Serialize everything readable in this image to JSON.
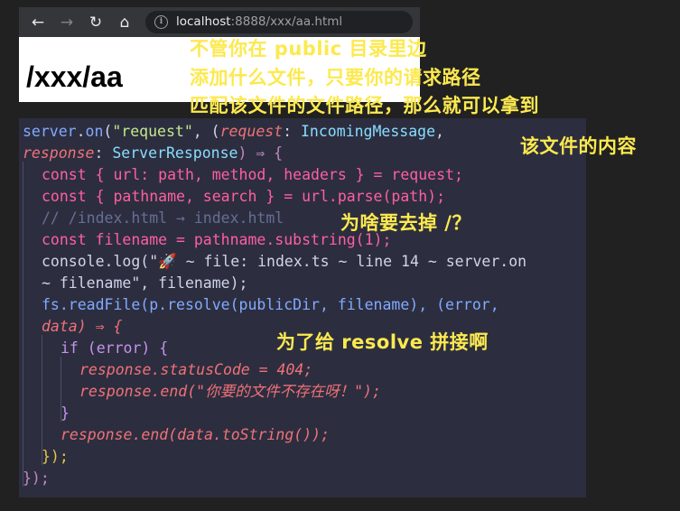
{
  "browser": {
    "url_host": "localhost",
    "url_rest": ":8888/xxx/aa.html",
    "page_heading": "/xxx/aa"
  },
  "notes": {
    "line1": "不管你在 public 目录里边",
    "line2": "添加什么文件，只要你的请求路径",
    "line3": "匹配该文件的文件路径，那么就可以拿到",
    "line4": "该文件的内容",
    "question": "为啥要去掉 /？",
    "answer": "为了给 resolve 拼接啊"
  },
  "code": {
    "l1a": "server",
    "l1b": ".",
    "l1c": "on",
    "l1d": "(",
    "l1e": "\"request\"",
    "l1f": ", (",
    "l1g": "request",
    "l1h": ": ",
    "l1i": "IncomingMessage",
    "l1j": ",",
    "l2a": "response",
    "l2b": ": ",
    "l2c": "ServerResponse",
    "l2d": ") ⇒ {",
    "l3": "const { url: path, method, headers } = request;",
    "l4": "const { pathname, search } = url.parse(path);",
    "l5": "// /index.html → index.html",
    "l6": "const filename = pathname.substring(1);",
    "l7": "console.log(\"🚀 ~ file: index.ts ~ line 14 ~ server.on",
    "l8": "~ filename\", filename);",
    "l9": "fs.readFile(p.resolve(publicDir, filename), (error,",
    "l10": "data) ⇒ {",
    "l11": "if (error) {",
    "l12": "response.statusCode = 404;",
    "l13": "response.end(\"你要的文件不存在呀！\");",
    "l14": "}",
    "l15": "response.end(data.toString());",
    "l16": "});",
    "l17": "});"
  }
}
